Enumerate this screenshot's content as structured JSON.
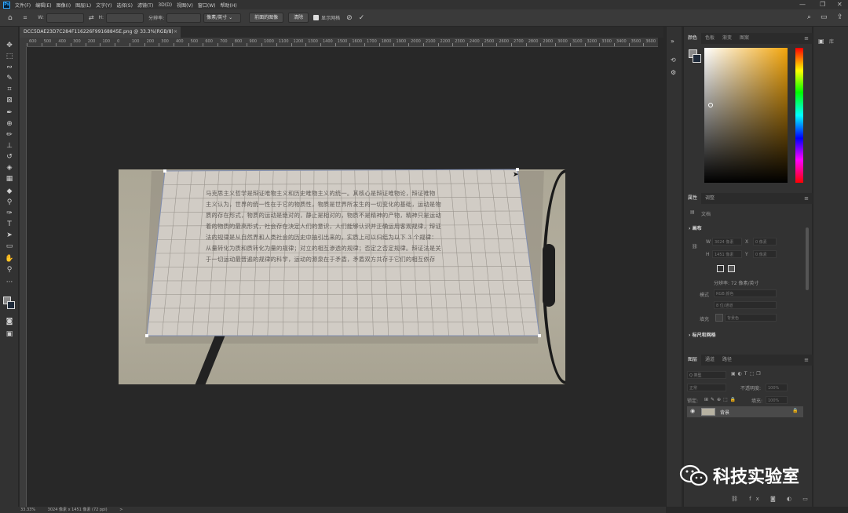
{
  "app": {
    "logo": "Ps"
  },
  "menu": [
    "文件(F)",
    "编辑(E)",
    "图像(I)",
    "图层(L)",
    "文字(Y)",
    "选择(S)",
    "滤镜(T)",
    "3D(D)",
    "视图(V)",
    "窗口(W)",
    "帮助(H)"
  ],
  "window_controls": [
    "—",
    "❐",
    "✕"
  ],
  "options": {
    "w_label": "W:",
    "h_label": "H:",
    "resolution_label": "分辨率:",
    "unit_select": "像素/英寸",
    "front_image_button": "前面的图像",
    "clear_button": "清除",
    "show_grid_label": "显示网格",
    "confirm_icon": "check-icon",
    "cancel_icon": "cancel-icon"
  },
  "document": {
    "tab_title": "DCC5DAE23D7C284F1162​26F99168845E.png @ 33.3%(RGB/8)",
    "tab_close": "×",
    "ruler_labels": [
      "600",
      "500",
      "400",
      "300",
      "200",
      "100",
      "0",
      "100",
      "200",
      "300",
      "400",
      "500",
      "600",
      "700",
      "800",
      "900",
      "1000",
      "1100",
      "1200",
      "1300",
      "1400",
      "1500",
      "1600",
      "1700",
      "1800",
      "1900",
      "2000",
      "2100",
      "2200",
      "2300",
      "2400",
      "2500",
      "2600",
      "2700",
      "2800",
      "2900",
      "3000",
      "3100",
      "3200",
      "3300",
      "3400",
      "3500",
      "3600"
    ],
    "text_lines": [
      "马克思主义哲学是辩证唯物主义和历史唯物主义的统一。其核心是辩证唯物论，辩证唯物",
      "主义认为，世界的统一性在于它的物质性，物质是世界所发生的一切变化的基础，运动是物",
      "质的存在形式，物质的运动是绝对的，静止是相对的，物质不是精神的产物，精神只是运动",
      "着的物质的最高形式，社会存在决定人们的意识，人们能够认识并正确运用客观规律，辩证",
      "法的规律是从自然界和人类社会的历史中抽引出来的，实质上可以归结为以下 3 个规律：",
      "从量转化为质和质转化为量的规律；对立的相互渗透的规律；否定之否定规律。辩证法是关",
      "于一切运动最普遍的规律的科学，运动的源泉在于矛盾，矛盾双方共存于它们的相互依存"
    ]
  },
  "statusbar": {
    "zoom": "33.33%",
    "doc_size": "3024 像素 x 1451 像素 (72 ppi)",
    "arrow": ">"
  },
  "color_panel": {
    "tabs": [
      "颜色",
      "色板",
      "渐变",
      "图案"
    ],
    "foreground": "#888888",
    "background": "#1e2a3a",
    "hue_accent": "#f2a50c"
  },
  "properties_panel": {
    "tabs": [
      "属性",
      "调整"
    ],
    "doc_label": "文档",
    "canvas_section": "画布",
    "w_label": "W",
    "h_label": "H",
    "w_value": "3024 像素",
    "h_value": "1451 像素",
    "x_label": "X",
    "y_label": "Y",
    "x_value": "0 像素",
    "y_value": "0 像素",
    "resolution": "分辨率: 72 像素/英寸",
    "mode_label": "模式",
    "mode_value": "RGB 颜色",
    "depth_value": "8 位/通道",
    "fill_label": "填充",
    "fill_value": "背景色",
    "rulers_section": "标尺和网格"
  },
  "layers_panel": {
    "tabs": [
      "图层",
      "通道",
      "路径"
    ],
    "search_placeholder": "Q 类型",
    "blend_mode": "正常",
    "opacity_label": "不透明度:",
    "opacity_value": "100%",
    "lock_label": "锁定:",
    "fill_label": "填充:",
    "fill_value": "100%",
    "layers": [
      {
        "name": "背景",
        "visible": true,
        "locked": true
      }
    ],
    "bottom_icons": [
      "link-icon",
      "fx-icon",
      "mask-icon",
      "adjustment-icon",
      "group-icon",
      "new-layer-icon",
      "trash-icon"
    ]
  },
  "watermark": {
    "text": "科技实验室"
  }
}
